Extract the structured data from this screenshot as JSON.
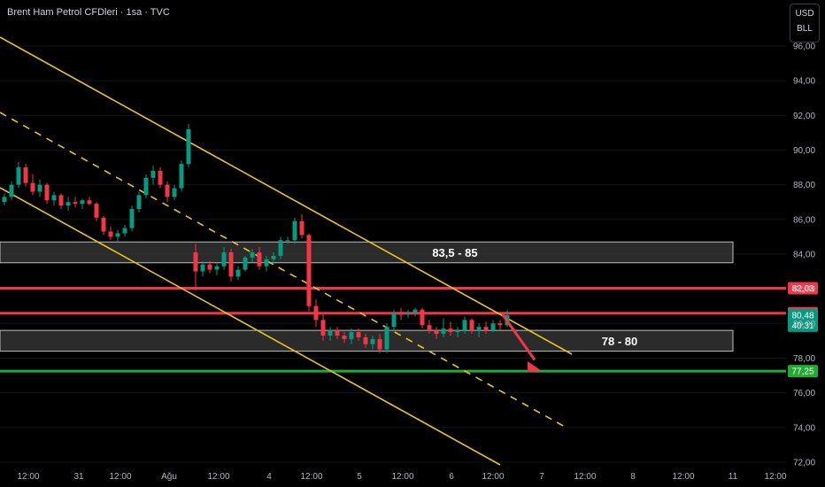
{
  "header": {
    "title": "Brent Ham Petrol CFDleri · 1sa · TVC"
  },
  "unit_selector": {
    "currency": "USD",
    "unit": "BLL"
  },
  "chart_data": {
    "type": "candlestick",
    "title": "Brent Ham Petrol CFDleri · 1sa · TVC",
    "ylim": [
      71.5,
      97.5
    ],
    "y_ticks": [
      72,
      74,
      76,
      78,
      80,
      82,
      84,
      86,
      88,
      90,
      92,
      94,
      96
    ],
    "y_tick_labels": [
      "72,00",
      "74,00",
      "76,00",
      "78,00",
      "80,00",
      "82,00",
      "84,00",
      "86,00",
      "88,00",
      "90,00",
      "92,00",
      "94,00",
      "96,00"
    ],
    "x_ticks": [
      "12:00",
      "31",
      "12:00",
      "Ağu",
      "12:00",
      "4",
      "12:00",
      "5",
      "12:00",
      "6",
      "12:00",
      "7",
      "12:00",
      "8",
      "12:00",
      "11",
      "12:00"
    ],
    "zones": [
      {
        "label": "83,5 - 85",
        "low": 83.5,
        "high": 84.7
      },
      {
        "label": "78 - 80",
        "low": 78.4,
        "high": 79.6
      }
    ],
    "levels": [
      {
        "value": 82.03,
        "label": "82,03",
        "color": "#f23645"
      },
      {
        "value": 80.59,
        "label": "80,59",
        "color": "#f23645"
      },
      {
        "value": 77.25,
        "label": "77,25",
        "color": "#22ab34"
      }
    ],
    "last_price": {
      "value": 80.48,
      "label": "80,48",
      "countdown": "40:31",
      "color": "#089981"
    },
    "candles": [
      [
        87.0,
        87.5,
        86.8,
        87.3
      ],
      [
        87.3,
        88.2,
        87.1,
        88.0
      ],
      [
        88.0,
        89.3,
        87.8,
        89.0
      ],
      [
        89.0,
        89.2,
        87.9,
        88.1
      ],
      [
        88.1,
        88.6,
        87.4,
        87.6
      ],
      [
        87.6,
        88.3,
        87.3,
        88.0
      ],
      [
        88.0,
        88.1,
        86.9,
        87.1
      ],
      [
        87.1,
        87.6,
        86.8,
        87.4
      ],
      [
        87.4,
        87.5,
        86.6,
        86.8
      ],
      [
        86.8,
        87.3,
        86.5,
        87.0
      ],
      [
        87.0,
        87.3,
        86.7,
        86.9
      ],
      [
        86.9,
        87.2,
        86.6,
        87.1
      ],
      [
        87.1,
        87.3,
        86.8,
        86.9
      ],
      [
        86.9,
        87.0,
        85.9,
        86.1
      ],
      [
        86.1,
        86.2,
        85.1,
        85.3
      ],
      [
        85.3,
        85.6,
        84.8,
        85.0
      ],
      [
        85.0,
        85.4,
        84.7,
        85.2
      ],
      [
        85.2,
        85.7,
        85.0,
        85.5
      ],
      [
        85.5,
        86.8,
        85.3,
        86.6
      ],
      [
        86.6,
        87.6,
        86.4,
        87.4
      ],
      [
        87.4,
        88.6,
        87.2,
        88.4
      ],
      [
        88.4,
        89.1,
        88.0,
        88.8
      ],
      [
        88.8,
        89.0,
        87.8,
        88.0
      ],
      [
        88.0,
        88.2,
        87.0,
        87.3
      ],
      [
        87.3,
        88.0,
        87.1,
        87.8
      ],
      [
        87.8,
        89.4,
        87.6,
        89.2
      ],
      [
        89.2,
        91.5,
        89.0,
        91.2
      ],
      [
        84.1,
        84.6,
        81.9,
        83.0
      ],
      [
        83.0,
        83.6,
        82.7,
        83.4
      ],
      [
        83.4,
        83.6,
        82.9,
        83.1
      ],
      [
        83.1,
        83.5,
        82.8,
        83.3
      ],
      [
        83.3,
        84.4,
        83.1,
        84.1
      ],
      [
        84.1,
        84.3,
        82.4,
        82.7
      ],
      [
        82.7,
        83.3,
        82.5,
        83.1
      ],
      [
        83.1,
        83.9,
        83.0,
        83.8
      ],
      [
        83.8,
        84.3,
        83.5,
        84.1
      ],
      [
        84.1,
        84.4,
        83.1,
        83.3
      ],
      [
        83.3,
        83.9,
        83.0,
        83.7
      ],
      [
        83.7,
        84.1,
        83.4,
        83.9
      ],
      [
        83.9,
        85.0,
        83.7,
        84.8
      ],
      [
        84.8,
        85.0,
        84.6,
        84.8
      ],
      [
        84.8,
        86.1,
        84.6,
        85.9
      ],
      [
        85.9,
        86.3,
        84.9,
        85.1
      ],
      [
        85.1,
        85.2,
        80.7,
        81.0
      ],
      [
        81.0,
        81.4,
        79.8,
        80.2
      ],
      [
        80.2,
        80.6,
        79.0,
        79.3
      ],
      [
        79.3,
        79.8,
        79.0,
        79.6
      ],
      [
        79.6,
        79.8,
        79.1,
        79.3
      ],
      [
        79.3,
        79.5,
        78.9,
        79.1
      ],
      [
        79.1,
        79.7,
        78.8,
        79.5
      ],
      [
        79.5,
        79.7,
        79.0,
        79.2
      ],
      [
        79.2,
        79.4,
        78.6,
        78.8
      ],
      [
        78.8,
        79.3,
        78.5,
        79.1
      ],
      [
        79.1,
        79.4,
        78.3,
        78.5
      ],
      [
        78.5,
        80.0,
        78.3,
        79.8
      ],
      [
        79.8,
        80.8,
        79.6,
        80.6
      ],
      [
        80.6,
        80.9,
        80.2,
        80.5
      ],
      [
        80.5,
        80.8,
        80.3,
        80.6
      ],
      [
        80.6,
        80.9,
        80.4,
        80.8
      ],
      [
        80.8,
        80.9,
        79.7,
        79.9
      ],
      [
        79.9,
        80.2,
        79.4,
        79.6
      ],
      [
        79.6,
        79.8,
        79.1,
        79.4
      ],
      [
        79.4,
        80.3,
        79.2,
        79.7
      ],
      [
        79.7,
        80.1,
        79.3,
        79.5
      ],
      [
        79.5,
        79.8,
        79.2,
        79.6
      ],
      [
        79.6,
        80.4,
        79.4,
        80.2
      ],
      [
        80.2,
        80.3,
        79.4,
        79.6
      ],
      [
        79.6,
        80.0,
        79.2,
        79.8
      ],
      [
        79.8,
        80.1,
        79.4,
        79.6
      ],
      [
        79.6,
        80.2,
        79.5,
        80.0
      ],
      [
        80.0,
        80.2,
        79.6,
        79.9
      ],
      [
        79.9,
        80.8,
        79.8,
        80.48
      ]
    ]
  }
}
